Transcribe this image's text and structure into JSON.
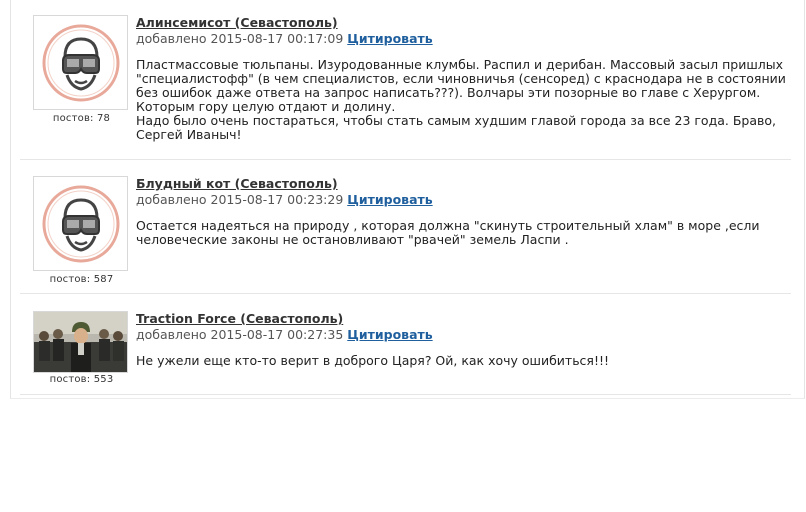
{
  "comments": [
    {
      "author": "Алинсемисот (Севастополь)",
      "added_label": "добавлено",
      "timestamp": "2015-08-17 00:17:09",
      "quote_label": "Цитировать",
      "posts": "постов: 78",
      "avatar": "goggles-avatar-icon",
      "lines": [
        "Пластмассовые тюльпаны. Изуродованные клумбы. Распил и дерибан. Массовый засыл пришлых",
        "\"специалистофф\" (в чем специалистов, если чиновничья (сенсоред) с краснодара не в состоянии",
        "без ошибок даже ответа на запрос написать???). Волчары эти позорные во главе с Херургом.",
        "Которым гору целую отдают и долину.",
        "Надо было очень постараться, чтобы стать самым худшим главой города за все 23 года. Браво,",
        "Сергей Иваныч!"
      ]
    },
    {
      "author": "Блудный  кот (Севастополь)",
      "added_label": "добавлено",
      "timestamp": "2015-08-17 00:23:29",
      "quote_label": "Цитировать",
      "posts": "постов: 587",
      "avatar": "goggles-avatar-icon",
      "lines": [
        "Остается надеяться на природу , которая должна \"скинуть строительный хлам\" в море ,если",
        "человеческие законы не остановливают \"рвачей\" земель Ласпи ."
      ]
    },
    {
      "author": "Traction Force (Севастополь)",
      "added_label": "добавлено",
      "timestamp": "2015-08-17 00:27:35",
      "quote_label": "Цитировать",
      "posts": "постов: 553",
      "avatar": "soldier-photo-avatar",
      "lines": [
        "Не ужели еще кто-то верит в доброго Царя? Ой, как хочу ошибиться!!!"
      ]
    }
  ]
}
